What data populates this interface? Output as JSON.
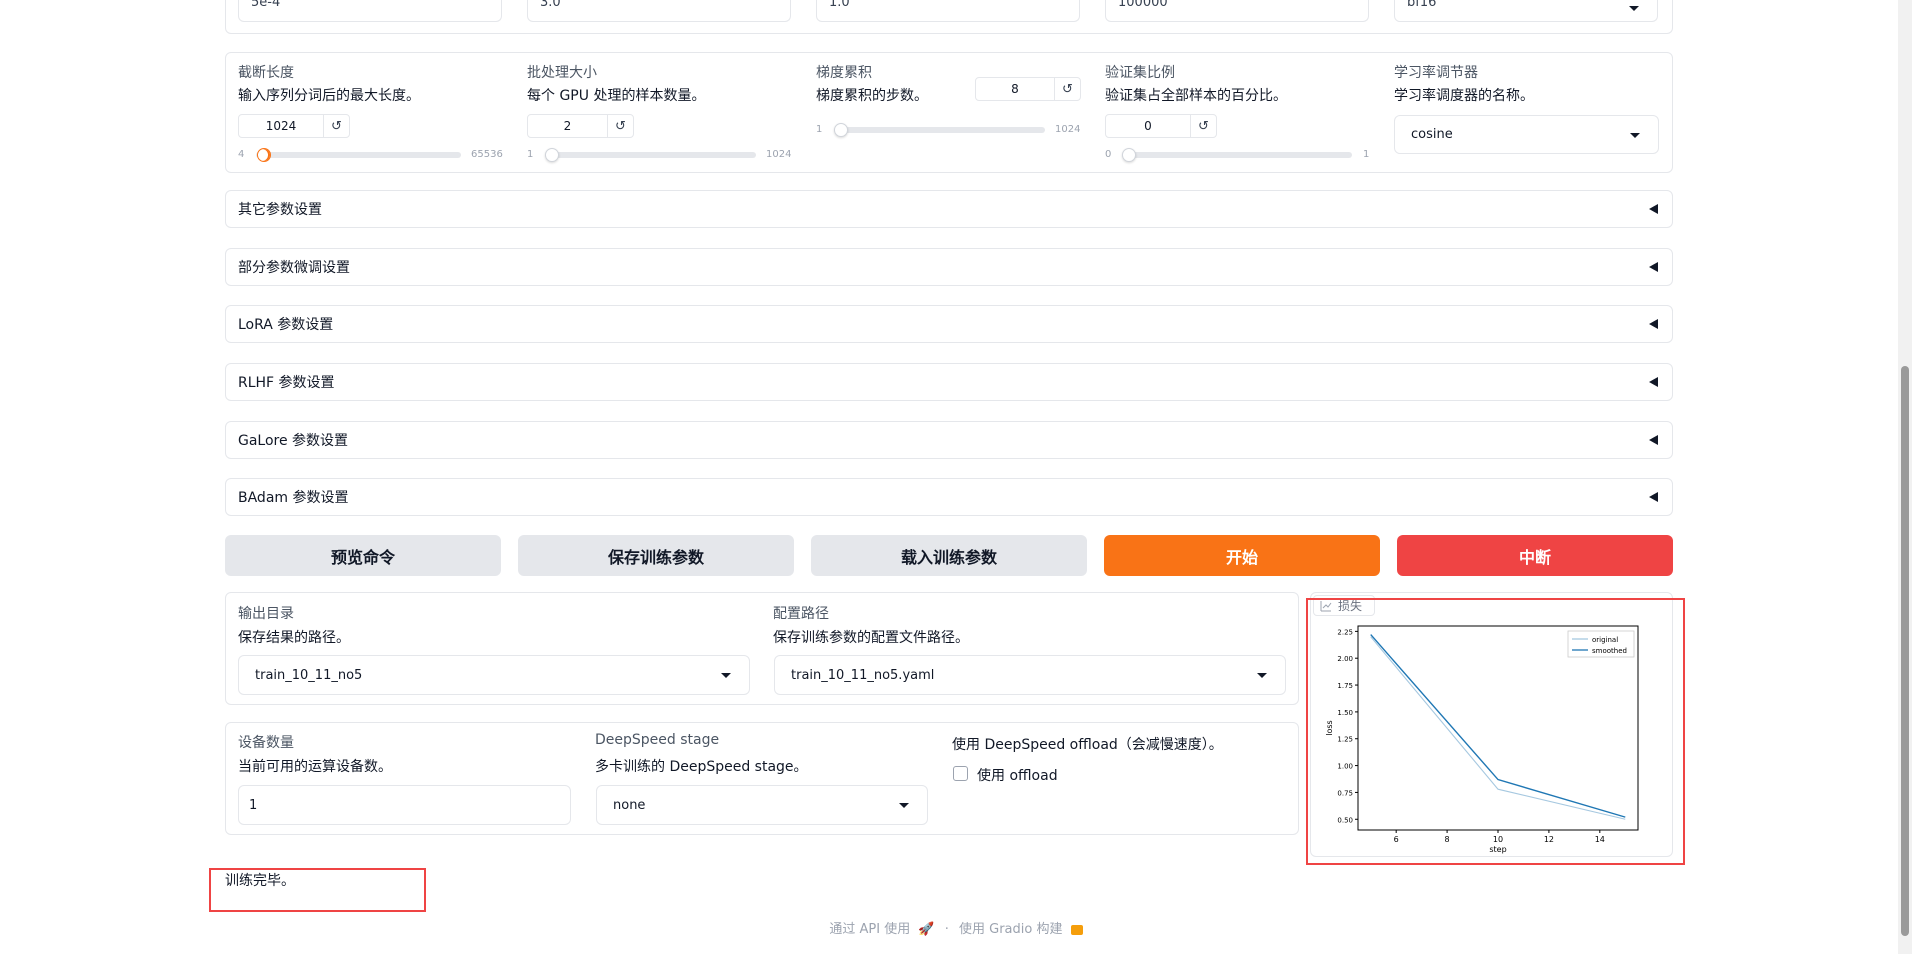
{
  "top_inputs": [
    "5e-4",
    "3.0",
    "1.0",
    "100000",
    "bf16"
  ],
  "row2": {
    "cutoff": {
      "label": "截断长度",
      "info": "输入序列分词后的最大长度。",
      "value": "1024",
      "min": "4",
      "max": "65536"
    },
    "batch": {
      "label": "批处理大小",
      "info": "每个 GPU 处理的样本数量。",
      "value": "2",
      "min": "1",
      "max": "1024"
    },
    "grad_accum": {
      "label": "梯度累积",
      "info": "梯度累积的步数。",
      "value": "8",
      "min": "1",
      "max": "1024"
    },
    "val_size": {
      "label": "验证集比例",
      "info": "验证集占全部样本的百分比。",
      "value": "0",
      "min": "0",
      "max": "1"
    },
    "scheduler": {
      "label": "学习率调节器",
      "info": "学习率调度器的名称。",
      "value": "cosine"
    }
  },
  "reset_glyph": "↺",
  "accordions": [
    "其它参数设置",
    "部分参数微调设置",
    "LoRA 参数设置",
    "RLHF 参数设置",
    "GaLore 参数设置",
    "BAdam 参数设置"
  ],
  "buttons": {
    "preview": "预览命令",
    "save": "保存训练参数",
    "load": "载入训练参数",
    "start": "开始",
    "stop": "中断"
  },
  "colors": {
    "start": "#f97316",
    "stop": "#ef4444",
    "highlight": "#ef4444"
  },
  "output": {
    "dir_label": "输出目录",
    "dir_info": "保存结果的路径。",
    "dir_value": "train_10_11_no5",
    "config_label": "配置路径",
    "config_info": "保存训练参数的配置文件路径。",
    "config_value": "train_10_11_no5.yaml"
  },
  "device": {
    "count_label": "设备数量",
    "count_info": "当前可用的运算设备数。",
    "count_value": "1",
    "ds_label": "DeepSpeed stage",
    "ds_info": "多卡训练的 DeepSpeed stage。",
    "ds_value": "none",
    "offload_label": "使用 DeepSpeed offload（会减慢速度）。",
    "offload_checkbox": "使用 offload"
  },
  "plot_label": "损失",
  "status_text": "训练完毕。",
  "footer": {
    "api": "通过 API 使用",
    "sep": "·",
    "built": "使用 Gradio 构建"
  },
  "chart_data": {
    "type": "line",
    "xlabel": "step",
    "ylabel": "loss",
    "xlim": [
      4.5,
      15.5
    ],
    "ylim": [
      0.4,
      2.3
    ],
    "xticks": [
      6,
      8,
      10,
      12,
      14
    ],
    "yticks": [
      0.5,
      0.75,
      1.0,
      1.25,
      1.5,
      1.75,
      2.0,
      2.25
    ],
    "ytick_labels": [
      "0.50",
      "0.75",
      "1.00",
      "1.25",
      "1.50",
      "1.75",
      "2.00",
      "2.25"
    ],
    "legend_position": "top-right",
    "series": [
      {
        "name": "original",
        "x": [
          5,
          10,
          15
        ],
        "y": [
          2.2,
          0.78,
          0.5
        ],
        "color": "#a6c8e0"
      },
      {
        "name": "smoothed",
        "x": [
          5,
          10,
          15
        ],
        "y": [
          2.22,
          0.87,
          0.52
        ],
        "color": "#1f77b4"
      }
    ]
  }
}
